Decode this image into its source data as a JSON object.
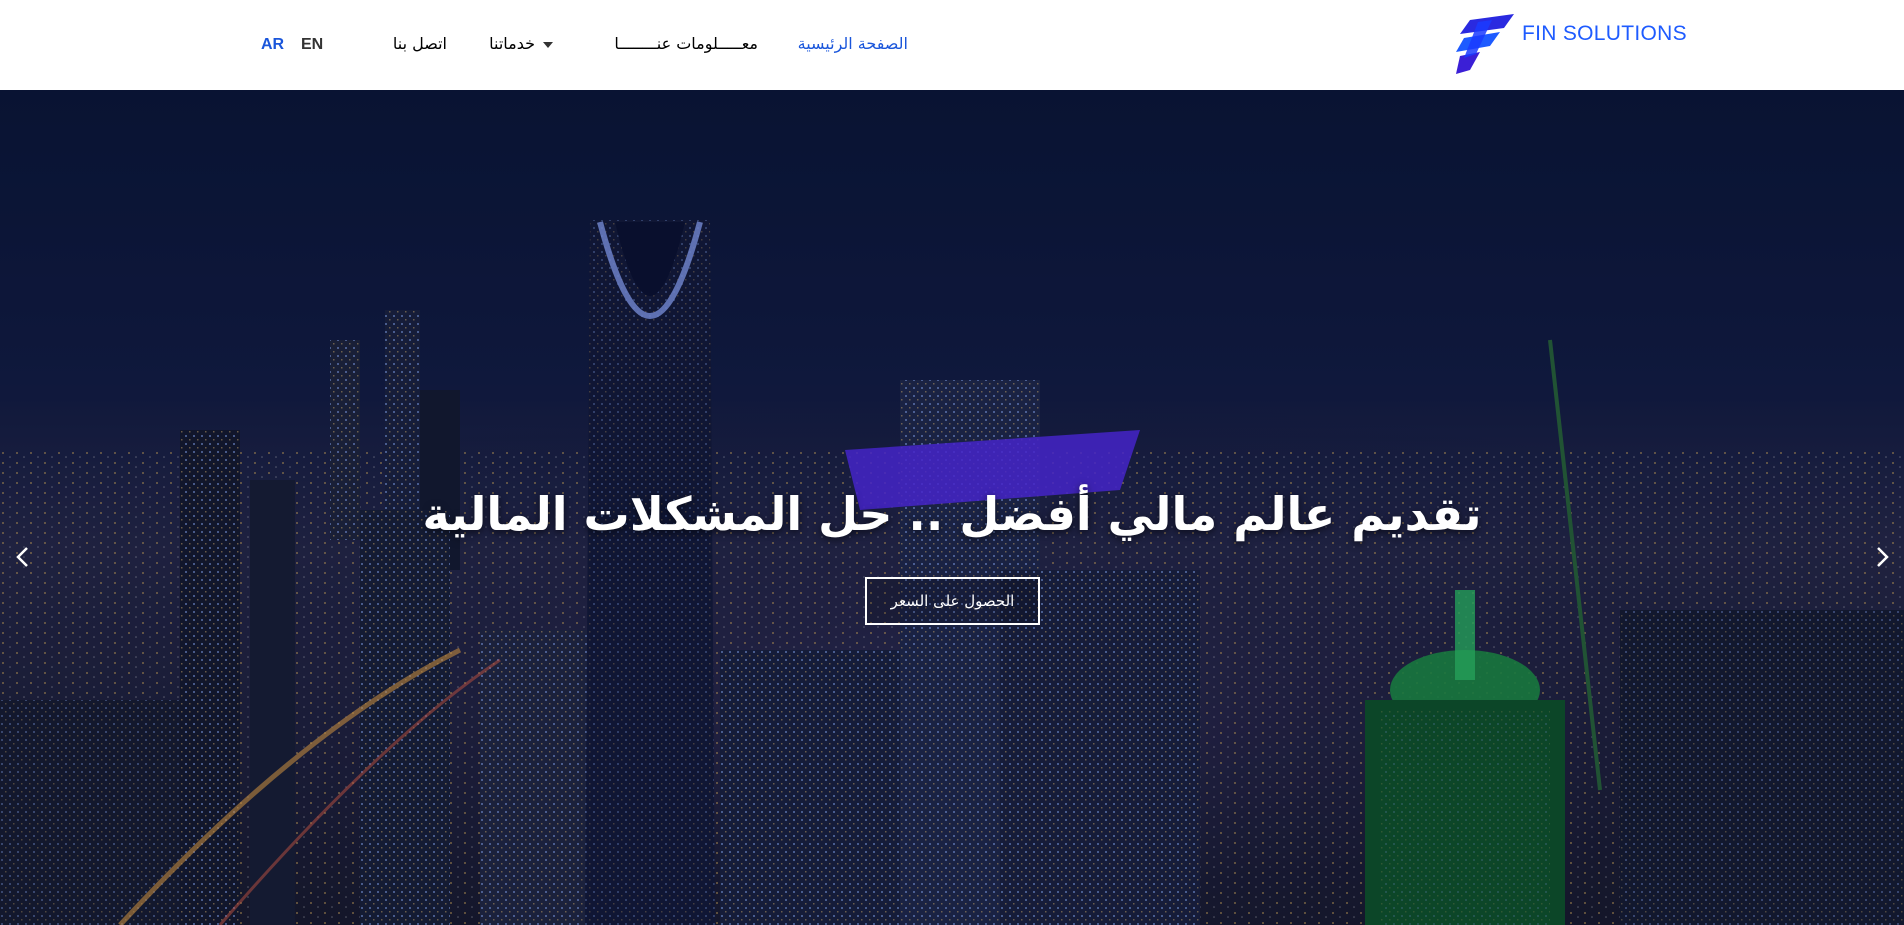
{
  "brand": {
    "name": "FIN SOLUTIONS",
    "logo_icon": "fin-solutions-logo-icon",
    "color": "#1e5bff"
  },
  "nav": {
    "home": "الصفحة الرئيسية",
    "about": "معـــــلومات عنــــــــا",
    "services": "خدماتنا",
    "contact": "اتصل بنا",
    "active": "home",
    "active_color": "#1a56db"
  },
  "language": {
    "ar": "AR",
    "en": "EN",
    "selected": "AR"
  },
  "hero": {
    "title": "تقديم عالم مالي أفضل .. حل المشكلات المالية",
    "cta_label": "الحصول على السعر",
    "prev_icon": "chevron-left-icon",
    "next_icon": "chevron-right-icon"
  }
}
